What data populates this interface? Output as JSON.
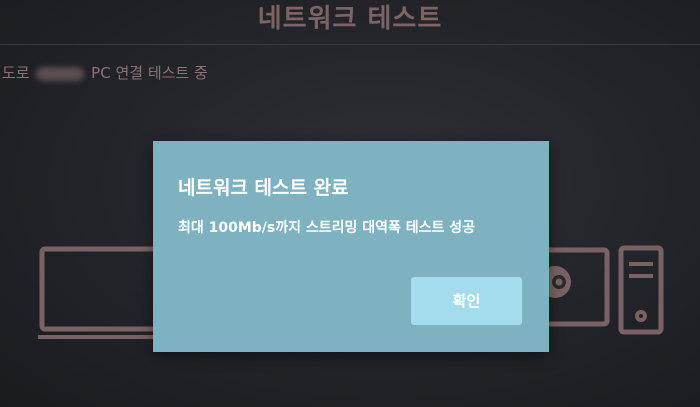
{
  "header": {
    "title": "네트워크 테스트"
  },
  "status": {
    "prefix": "도로",
    "suffix": "PC 연결 테스트 중"
  },
  "dialog": {
    "title": "네트워크 테스트 완료",
    "message": "최대 100Mb/s까지 스트리밍 대역폭 테스트 성공",
    "confirm_label": "확인"
  },
  "background_icons": [
    "tv-icon",
    "steam-logo-icon",
    "pc-tower-icon"
  ],
  "colors": {
    "dialog_background": "#7eb2c0",
    "button_background": "#a4dced",
    "muted_text": "#7d6364"
  }
}
